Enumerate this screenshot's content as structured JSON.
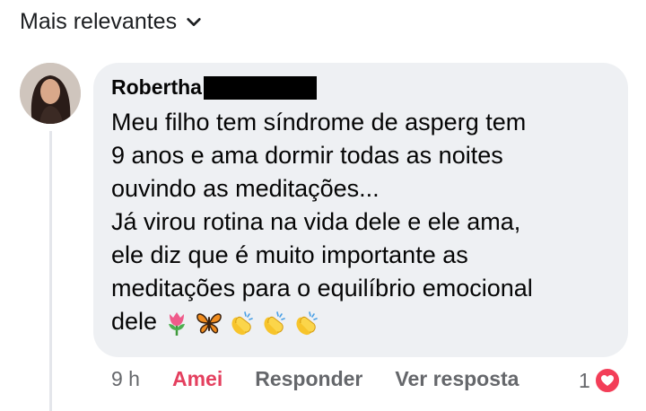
{
  "sort": {
    "label": "Mais relevantes"
  },
  "comment": {
    "author": "Robertha",
    "lines": [
      "Meu filho tem síndrome de asperg tem",
      "9 anos e ama dormir todas as noites",
      "ouvindo as meditações...",
      "Já virou rotina na vida dele e ele ama,",
      "ele diz que é muito importante as",
      "meditações para o equilíbrio emocional",
      "dele"
    ],
    "emojis": [
      "tulip-emoji",
      "butterfly-emoji",
      "clapping-hands-emoji",
      "clapping-hands-emoji",
      "clapping-hands-emoji"
    ]
  },
  "actions": {
    "time": "9 h",
    "like": "Amei",
    "reply": "Responder",
    "view_reply": "Ver resposta"
  },
  "reactions": {
    "count": "1",
    "icon": "heart-icon",
    "color": "#f33e58"
  }
}
